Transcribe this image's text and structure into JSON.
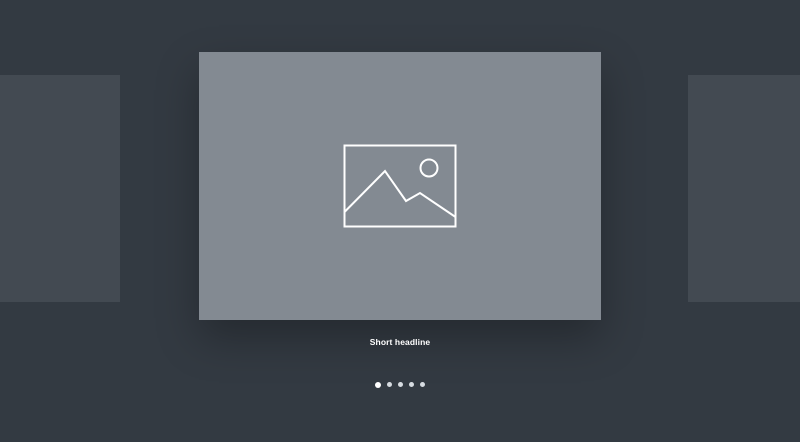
{
  "carousel": {
    "active_index": 0,
    "slide_count": 5,
    "caption": "Short headline",
    "main_slide": {
      "icon": "image-placeholder-icon"
    },
    "dots": [
      {
        "label": "",
        "active": true
      },
      {
        "label": "",
        "active": false
      },
      {
        "label": "",
        "active": false
      },
      {
        "label": "",
        "active": false
      },
      {
        "label": "",
        "active": false
      }
    ]
  },
  "colors": {
    "background": "#333a42",
    "side_slide": "#434a52",
    "main_slide": "#838a92",
    "icon_stroke": "#ffffff",
    "caption_text": "#ffffff",
    "dot": "#d7dce1"
  }
}
